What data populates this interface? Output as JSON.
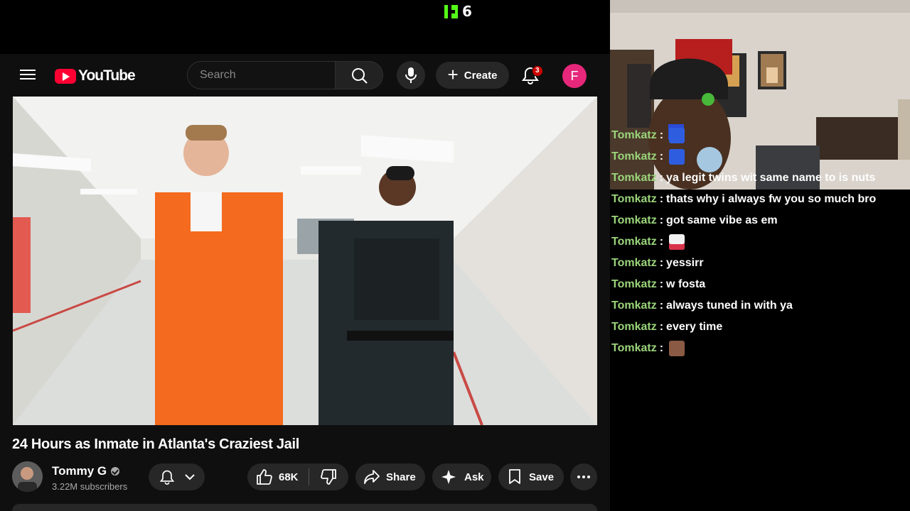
{
  "stream": {
    "platform_icon": "kick-logo-icon",
    "viewer_count": "6",
    "brand_color": "#53fc18"
  },
  "youtube": {
    "logo_text": "YouTube",
    "search_placeholder": "Search",
    "create_label": "Create",
    "notification_count": "3",
    "account_initial": "F",
    "video_title": "24 Hours as Inmate in Atlanta's Craziest Jail",
    "channel_name": "Tommy G",
    "subscribers": "3.22M subscribers",
    "like_count": "68K",
    "share_label": "Share",
    "ask_label": "Ask",
    "save_label": "Save"
  },
  "chat": [
    {
      "user": "Tomkatz",
      "message": "",
      "emote": "blue-emote-icon"
    },
    {
      "user": "Tomkatz",
      "message": "",
      "emote": "blue-emote-icon"
    },
    {
      "user": "Tomkatz",
      "message": "ya legit twins wit same name to is nuts"
    },
    {
      "user": "Tomkatz",
      "message": "thats why i always fw you so much bro"
    },
    {
      "user": "Tomkatz",
      "message": "got same vibe as em"
    },
    {
      "user": "Tomkatz",
      "message": "",
      "emote": "ghost-emote-icon"
    },
    {
      "user": "Tomkatz",
      "message": "yessirr"
    },
    {
      "user": "Tomkatz",
      "message": "w fosta"
    },
    {
      "user": "Tomkatz",
      "message": "always tuned in with ya"
    },
    {
      "user": "Tomkatz",
      "message": "every time"
    },
    {
      "user": "Tomkatz",
      "message": "",
      "emote": "person-emote-icon"
    }
  ]
}
